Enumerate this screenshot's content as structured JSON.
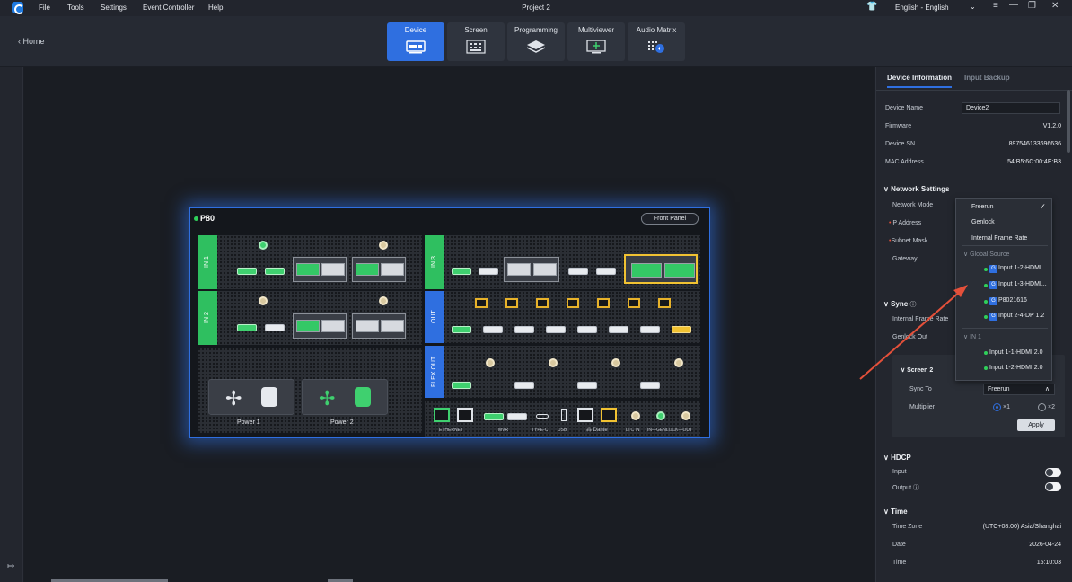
{
  "menubar": {
    "items": [
      "File",
      "Tools",
      "Settings",
      "Event Controller",
      "Help"
    ],
    "title": "Project 2",
    "language": "English - English"
  },
  "toolbar": {
    "home_label": "Home",
    "tabs": [
      {
        "label": "Device",
        "icon": "device-icon",
        "active": true
      },
      {
        "label": "Screen",
        "icon": "screen-grid-icon",
        "active": false
      },
      {
        "label": "Programming",
        "icon": "layers-icon",
        "active": false
      },
      {
        "label": "Multiviewer",
        "icon": "multiviewer-icon",
        "active": false
      },
      {
        "label": "Audio Matrix",
        "icon": "audio-matrix-icon",
        "active": false
      }
    ]
  },
  "device": {
    "name": "P80",
    "front_panel_label": "Front Panel",
    "modules": {
      "in1": "IN 1",
      "in2": "IN 2",
      "in3": "IN 3",
      "out": "OUT",
      "flex_out": "FLEX OUT"
    },
    "power": [
      "Power 1",
      "Power 2"
    ],
    "ports": {
      "ethernet": "ETHERNET",
      "mvr": "MVR",
      "typec": "TYPE-C",
      "usb": "USB",
      "dante": "Dante",
      "ltc_in": "LTC IN",
      "genlock": "IN—GENLOCK—OUT"
    }
  },
  "panel": {
    "tabs": [
      "Device Information",
      "Input Backup"
    ],
    "info": {
      "device_name_label": "Device Name",
      "device_name_value": "Device2",
      "firmware_label": "Firmware",
      "firmware_value": "V1.2.0",
      "sn_label": "Device SN",
      "sn_value": "897546133696636",
      "mac_label": "MAC Address",
      "mac_value": "54:B5:6C:00:4E:B3"
    },
    "network": {
      "title": "Network Settings",
      "mode_label": "Network Mode",
      "ip_label": "IP Address",
      "mask_label": "Subnet Mask",
      "gateway_label": "Gateway"
    },
    "sync": {
      "title": "Sync",
      "frame_rate_label": "Internal Frame Rate",
      "genlock_out_label": "Genlock Out",
      "screen_title": "Screen 2",
      "sync_to_label": "Sync To",
      "sync_to_value": "Freerun",
      "multiplier_label": "Multiplier",
      "mult_x1": "×1",
      "mult_x2": "×2",
      "apply_label": "Apply"
    },
    "hdcp": {
      "title": "HDCP",
      "input_label": "Input",
      "output_label": "Output"
    },
    "time": {
      "title": "Time",
      "tz_label": "Time Zone",
      "tz_value": "(UTC+08:00) Asia/Shanghai",
      "date_label": "Date",
      "date_value": "2026-04-24",
      "time_label": "Time",
      "time_value": "15:10:03"
    }
  },
  "dropdown": {
    "items": [
      "Freerun",
      "Genlock",
      "Internal Frame Rate"
    ],
    "check": "✓",
    "global_group": "Global Source",
    "global_sources": [
      "Input 1-2-HDMI...",
      "Input 1-3-HDMI...",
      "P8021616",
      "Input 2-4-DP 1.2"
    ],
    "in1_group": "IN 1",
    "in1_sources": [
      "Input 1-1-HDMI 2.0",
      "Input 1-2-HDMI 2.0"
    ],
    "badge": "G"
  },
  "colors": {
    "accent": "#2f6fe0",
    "green": "#2fbf60",
    "arrow": "#e4503a"
  }
}
